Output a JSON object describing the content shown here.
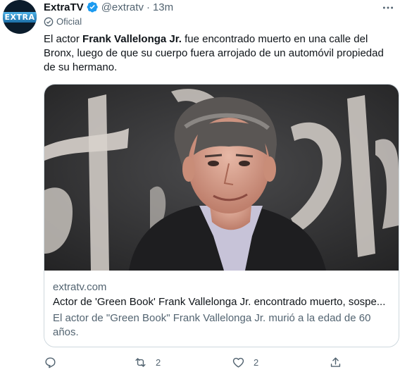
{
  "author": {
    "display_name": "ExtraTV",
    "handle": "@extratv",
    "time": "13m",
    "avatar_text": "EXTRA",
    "label": "Oficial"
  },
  "tweet": {
    "text_before": "El actor ",
    "text_bold": "Frank Vallelonga Jr.",
    "text_after": " fue encontrado muerto en una calle del Bronx, luego de que su cuerpo fuera arrojado de un automóvil propiedad de su hermano."
  },
  "card": {
    "domain": "extratv.com",
    "title": "Actor de 'Green Book' Frank Vallelonga Jr. encontrado muerto, sospe...",
    "description": "El actor de \"Green Book\" Frank Vallelonga Jr. murió a la edad de 60 años."
  },
  "actions": {
    "reply_count": "",
    "retweet_count": "2",
    "like_count": "2"
  },
  "icons": [
    "verified-icon",
    "more-icon",
    "official-label-icon",
    "reply-icon",
    "retweet-icon",
    "like-icon",
    "share-icon"
  ],
  "colors": {
    "verified": "#1d9bf0",
    "secondary_text": "#536471",
    "primary_text": "#0f1419",
    "border": "#cfd9de",
    "avatar_bg": "#0b1c2c"
  }
}
